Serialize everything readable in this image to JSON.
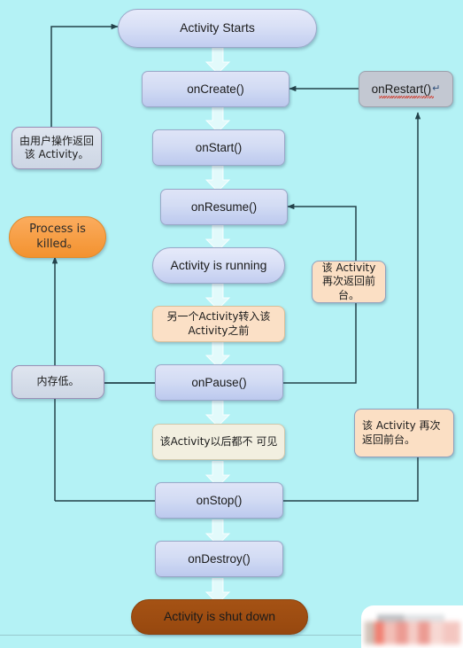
{
  "diagram": {
    "title": "Android Activity Lifecycle",
    "background_color": "#b4f2f5"
  },
  "nodes": {
    "activity_starts": "Activity Starts",
    "on_create": "onCreate()",
    "on_start": "onStart()",
    "on_resume": "onResume()",
    "activity_running": "Activity is running",
    "on_pause": "onPause()",
    "on_stop": "onStop()",
    "on_destroy": "onDestroy()",
    "activity_shut_down": "Activity is shut down",
    "on_restart": "onRestart()",
    "on_restart_mark": "↵",
    "process_killed": "Process is killed。"
  },
  "notes": {
    "user_returns": "由用户操作返回该 Activity。",
    "low_memory": "内存低。",
    "another_activity": "另一个Activity转入该Activity之前",
    "not_visible": "该Activity以后都不 可见",
    "return_foreground_1": "该 Activity 再次返回前台。",
    "return_foreground_2": "该 Activity 再次返回前台。"
  },
  "colors": {
    "background": "#b4f2f5",
    "process_box": "#d3dcf4",
    "process_border": "#9aa7c8",
    "killed_pill": "#f3922f",
    "shutdown_pill": "#97480f",
    "note_peach": "#fbdfc4",
    "note_ivory": "#f2efe0",
    "restart_box": "#c3c8d2",
    "connector": "#2b4a52",
    "spellcheck_underline": "#d03020"
  }
}
